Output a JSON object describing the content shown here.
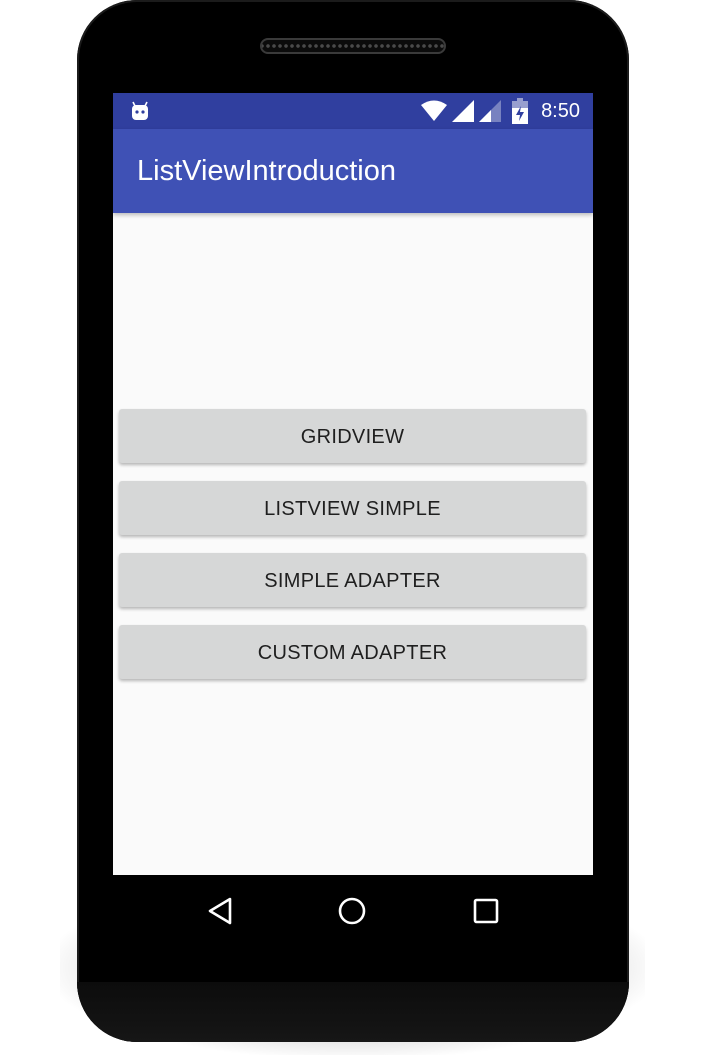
{
  "status_bar": {
    "time": "8:50",
    "background": "#303f9f",
    "icons": [
      "android-debug-icon",
      "wifi-icon",
      "cell-signal-icon",
      "cell-signal-weak-icon",
      "battery-charging-icon"
    ]
  },
  "app_bar": {
    "title": "ListViewIntroduction",
    "background": "#3f51b5"
  },
  "buttons": [
    {
      "label": "GRIDVIEW"
    },
    {
      "label": "LISTVIEW SIMPLE"
    },
    {
      "label": "SIMPLE ADAPTER"
    },
    {
      "label": "CUSTOM ADAPTER"
    }
  ],
  "navigation_bar": {
    "icons": [
      "back-icon",
      "home-icon",
      "recents-icon"
    ]
  },
  "colors": {
    "button_background": "#d6d7d7",
    "screen_background": "#fafafa"
  }
}
